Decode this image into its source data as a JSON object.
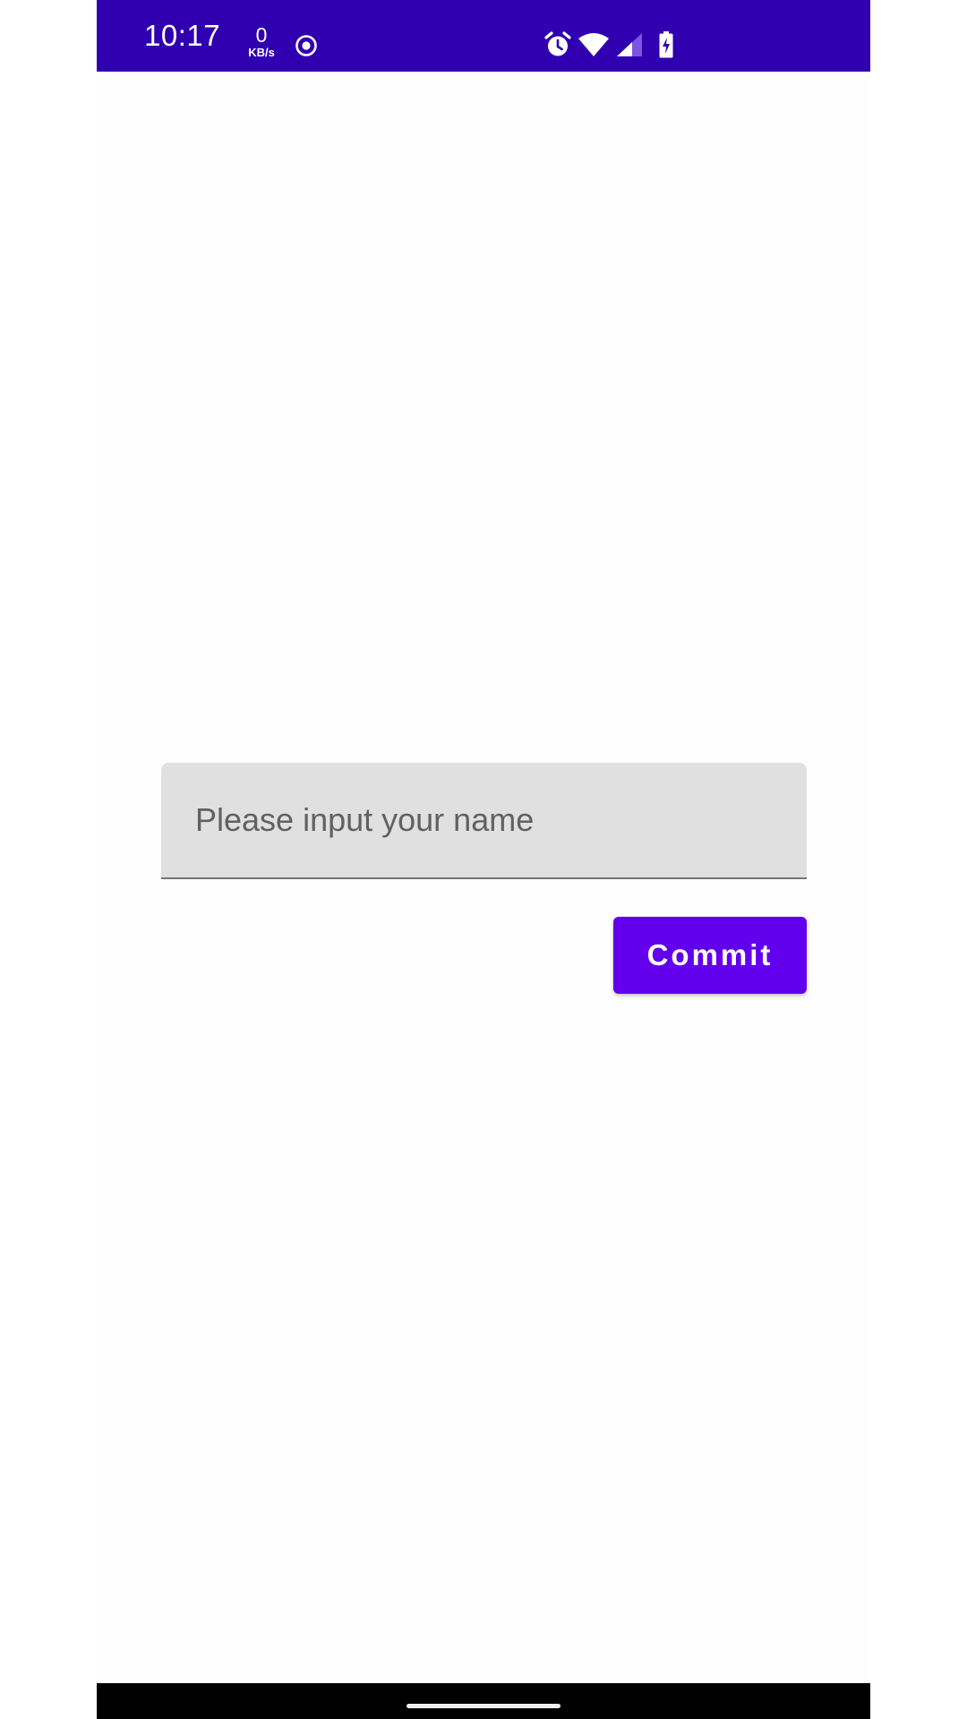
{
  "colors": {
    "status_bar": "#3000b0",
    "accent": "#6200ee",
    "background": "#fefefe",
    "field_background": "#e0e0e0",
    "nav_bar": "#000000"
  },
  "status_bar": {
    "time": "10:17",
    "net_speed_value": "0",
    "net_speed_unit": "KB/s",
    "icons": [
      "cast-icon",
      "alarm-icon",
      "wifi-icon",
      "signal-icon",
      "battery-charging-icon"
    ]
  },
  "form": {
    "name_field": {
      "placeholder": "Please input your name",
      "value": ""
    },
    "commit_label": "Commit"
  }
}
